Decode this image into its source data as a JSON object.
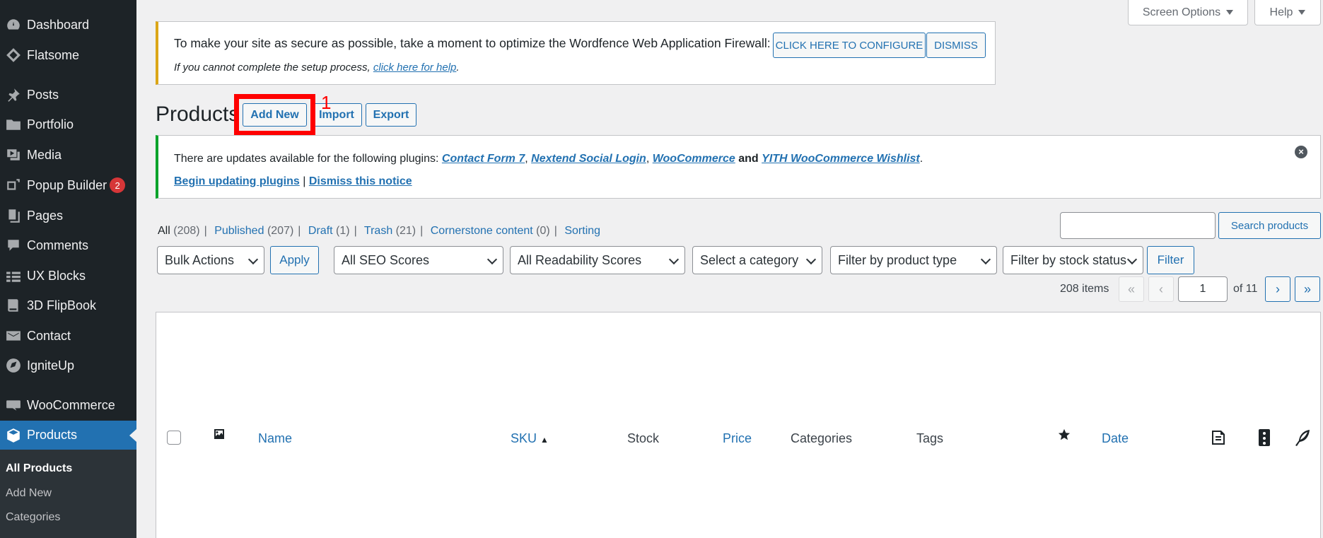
{
  "sidebar": {
    "items": [
      {
        "label": "Dashboard",
        "icon": "dashboard-icon"
      },
      {
        "label": "Flatsome",
        "icon": "flatsome-icon"
      },
      {
        "label": "Posts",
        "icon": "pin-icon"
      },
      {
        "label": "Portfolio",
        "icon": "folder-icon"
      },
      {
        "label": "Media",
        "icon": "media-icon"
      },
      {
        "label": "Popup Builder",
        "icon": "popup-icon",
        "badge": "2"
      },
      {
        "label": "Pages",
        "icon": "pages-icon"
      },
      {
        "label": "Comments",
        "icon": "comment-icon"
      },
      {
        "label": "UX Blocks",
        "icon": "blocks-icon"
      },
      {
        "label": "3D FlipBook",
        "icon": "book-icon"
      },
      {
        "label": "Contact",
        "icon": "mail-icon"
      },
      {
        "label": "IgniteUp",
        "icon": "rocket-icon"
      },
      {
        "label": "WooCommerce",
        "icon": "woo-icon"
      },
      {
        "label": "Products",
        "icon": "product-icon",
        "current": true
      }
    ],
    "submenu": [
      "All Products",
      "Add New",
      "Categories"
    ]
  },
  "top_tabs": {
    "screen_options": "Screen Options",
    "help": "Help"
  },
  "wordfence_notice": {
    "text": "To make your site as secure as possible, take a moment to optimize the Wordfence Web Application Firewall:",
    "configure_btn": "CLICK HERE TO CONFIGURE",
    "dismiss_btn": "DISMISS",
    "sub_prefix": "If you cannot complete the setup process,",
    "sub_link": "click here for help",
    "sub_suffix": "."
  },
  "page": {
    "title": "Products",
    "add_new": "Add New",
    "import": "Import",
    "export": "Export",
    "annotation": "1"
  },
  "update_notice": {
    "prefix": "There are updates available for the following plugins:",
    "plugins": [
      "Contact Form 7",
      "Nextend Social Login",
      "WooCommerce",
      "YITH WooCommerce Wishlist"
    ],
    "and": "and",
    "begin": "Begin updating plugins",
    "sep": "|",
    "dismiss": "Dismiss this notice",
    "close": "×"
  },
  "views": {
    "all": "All",
    "all_count": "(208)",
    "published": "Published",
    "published_count": "(207)",
    "drafts": "Draft",
    "drafts_count": "(1)",
    "trash": "Trash",
    "trash_count": "(21)",
    "cornerstone": "Cornerstone content",
    "cornerstone_count": "(0)",
    "sorting": "Sorting"
  },
  "search": {
    "button": "Search products",
    "value": ""
  },
  "filters": {
    "bulk_actions": "Bulk Actions",
    "apply": "Apply",
    "seo": "All SEO Scores",
    "readability": "All Readability Scores",
    "category": "Select a category",
    "product_type": "Filter by product type",
    "stock_status": "Filter by stock status",
    "filter": "Filter"
  },
  "pagination": {
    "items": "208 items",
    "first": "«",
    "prev": "‹",
    "current_page": "1",
    "of": "of 11",
    "next": "›",
    "last": "»"
  },
  "table_headers": {
    "name": "Name",
    "sku": "SKU",
    "stock": "Stock",
    "price": "Price",
    "categories": "Categories",
    "tags": "Tags",
    "date": "Date"
  }
}
